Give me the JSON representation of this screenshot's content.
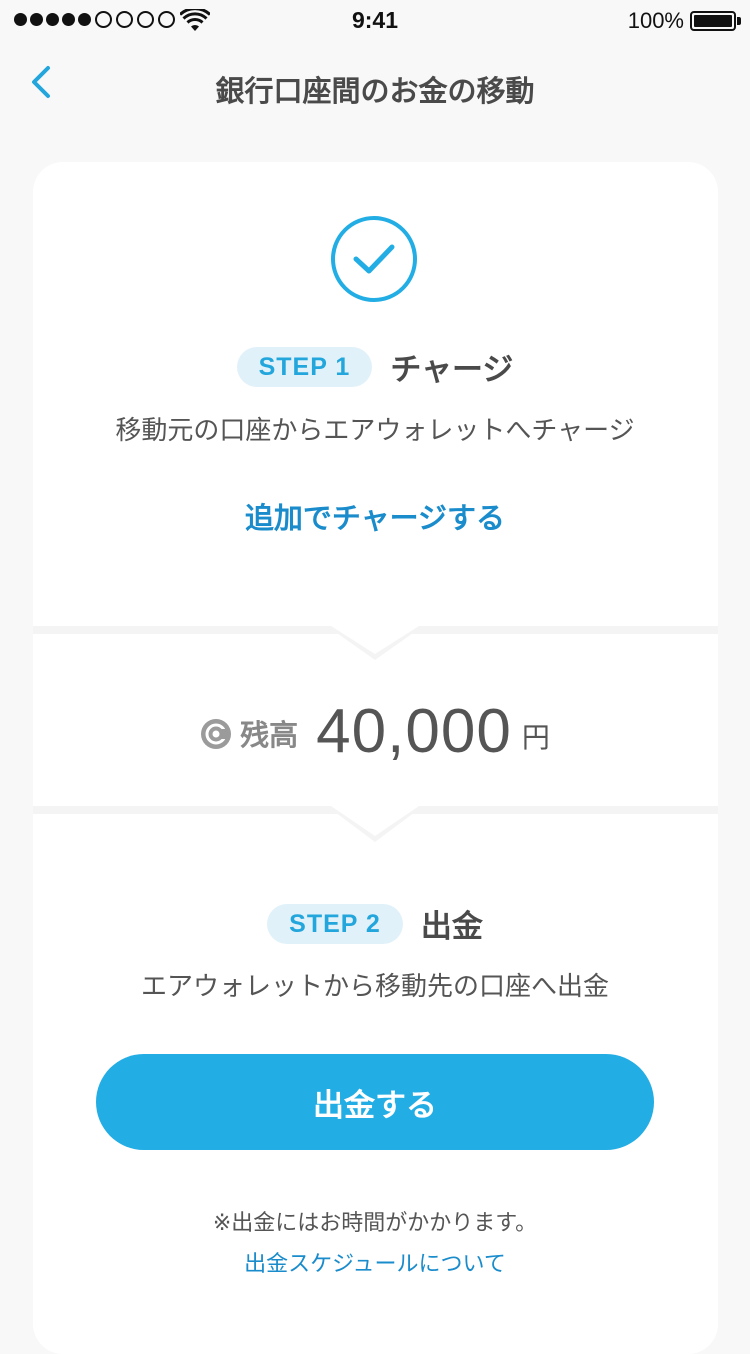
{
  "status_bar": {
    "time": "9:41",
    "battery_percent": "100%",
    "signal_filled_dots": 5,
    "signal_empty_dots": 4
  },
  "nav": {
    "title": "銀行口座間のお金の移動",
    "back_icon": "chevron-left-icon"
  },
  "step1": {
    "badge": "STEP 1",
    "title": "チャージ",
    "description": "移動元の口座からエアウォレットへチャージ",
    "link": "追加でチャージする",
    "status_icon": "check-circle-icon"
  },
  "balance": {
    "label": "残高",
    "value": "40,000",
    "unit": "円",
    "icon": "coin-icon"
  },
  "step2": {
    "badge": "STEP 2",
    "title": "出金",
    "description": "エアウォレットから移動先の口座へ出金",
    "button": "出金する",
    "note": "※出金にはお時間がかかります。",
    "link": "出金スケジュールについて"
  },
  "colors": {
    "accent": "#22ade4",
    "link": "#1a8ccc",
    "badge_bg": "#e1f1fa",
    "page_bg": "#f8f8f8"
  }
}
